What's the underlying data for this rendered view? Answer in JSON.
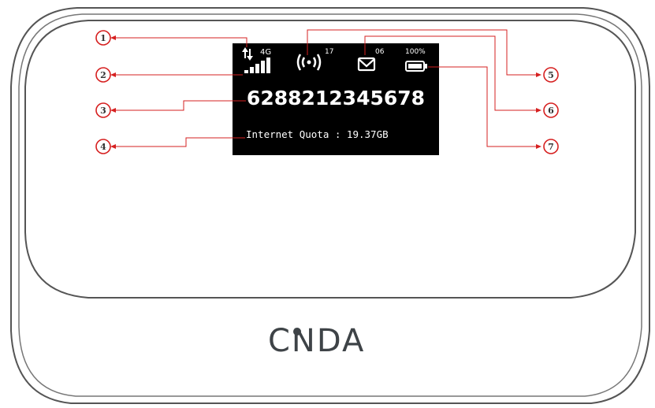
{
  "screen": {
    "network_type": "4G",
    "wifi_users": "17",
    "sms_count": "06",
    "battery": "100%",
    "phone_number": "6288212345678",
    "quota_text": "Internet Quota : 19.37GB"
  },
  "brand": {
    "logo_text": "CNDA"
  },
  "callouts": [
    "1",
    "2",
    "3",
    "4",
    "5",
    "6",
    "7"
  ],
  "colors": {
    "callout_line": "#d62020",
    "screen_bg": "#000000",
    "device_outline": "#555555"
  },
  "icons": {
    "signal": "signal-bars-icon",
    "transfer": "data-transfer-icon",
    "wifi": "wifi-hotspot-icon",
    "sms": "envelope-icon",
    "battery": "battery-icon"
  }
}
